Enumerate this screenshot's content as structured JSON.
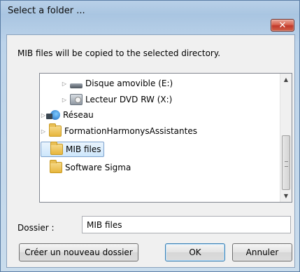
{
  "window": {
    "title": "Select a folder ...",
    "close_glyph": "✕"
  },
  "message": "MIB files will be copied to the selected directory.",
  "tree": {
    "items": [
      {
        "label": "Disque amovible (E:)",
        "icon": "removable-drive-icon",
        "expander": "▷"
      },
      {
        "label": "Lecteur DVD RW (X:)",
        "icon": "dvd-drive-icon",
        "expander": "▷"
      },
      {
        "label": "Réseau",
        "icon": "network-icon",
        "expander": "▷"
      },
      {
        "label": "FormationHarmonysAssistantes",
        "icon": "folder-icon",
        "expander": "▷"
      },
      {
        "label": "MIB files",
        "icon": "folder-icon",
        "expander": "",
        "selected": true
      },
      {
        "label": "Software Sigma",
        "icon": "folder-icon",
        "expander": ""
      }
    ]
  },
  "folder_field": {
    "label": "Dossier :",
    "value": "MIB files"
  },
  "buttons": {
    "new_folder": "Créer un nouveau dossier",
    "ok": "OK",
    "cancel": "Annuler"
  },
  "scrollbar": {
    "up_glyph": "▲",
    "down_glyph": "▼"
  }
}
